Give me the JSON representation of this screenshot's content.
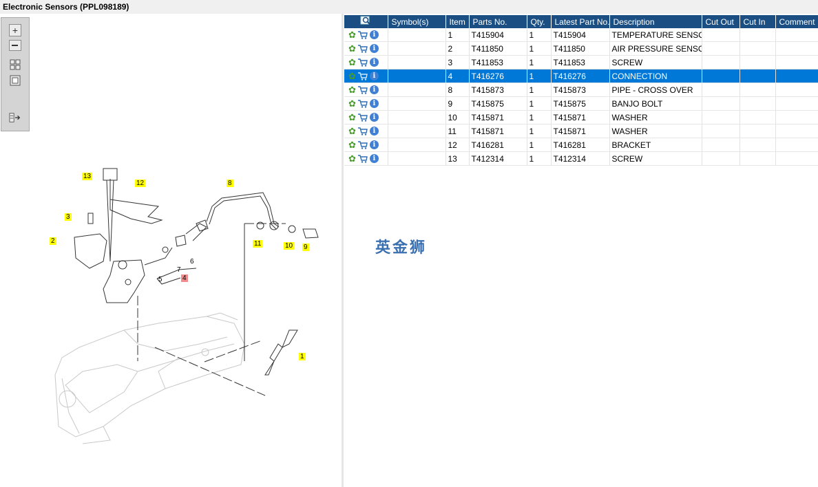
{
  "window": {
    "title": "Electronic Sensors (PPL098189)"
  },
  "toolbar": {
    "zoom_in_icon": "zoom-in-icon",
    "zoom_out_icon": "zoom-out-icon",
    "fit_icon": "fit-page-icon",
    "actual_size_icon": "actual-size-icon",
    "layout_icon": "layout-toggle-icon"
  },
  "drawing": {
    "callouts": [
      "13",
      "12",
      "8",
      "3",
      "2",
      "11",
      "10",
      "9",
      "4",
      "1"
    ],
    "labels": [
      "5",
      "6",
      "7"
    ]
  },
  "table": {
    "headers": {
      "actions": "",
      "symbols": "Symbol(s)",
      "item": "Item",
      "parts_no": "Parts No.",
      "qty": "Qty.",
      "latest": "Latest Part No.",
      "description": "Description",
      "cut_out": "Cut Out",
      "cut_in": "Cut In",
      "comment": "Comment"
    },
    "rows": [
      {
        "item": "1",
        "parts_no": "T415904",
        "qty": "1",
        "latest": "T415904",
        "description": "TEMPERATURE SENSOR"
      },
      {
        "item": "2",
        "parts_no": "T411850",
        "qty": "1",
        "latest": "T411850",
        "description": "AIR PRESSURE SENSOR"
      },
      {
        "item": "3",
        "parts_no": "T411853",
        "qty": "1",
        "latest": "T411853",
        "description": "SCREW"
      },
      {
        "item": "4",
        "parts_no": "T416276",
        "qty": "1",
        "latest": "T416276",
        "description": "CONNECTION",
        "selected": true
      },
      {
        "item": "8",
        "parts_no": "T415873",
        "qty": "1",
        "latest": "T415873",
        "description": "PIPE - CROSS OVER"
      },
      {
        "item": "9",
        "parts_no": "T415875",
        "qty": "1",
        "latest": "T415875",
        "description": "BANJO BOLT"
      },
      {
        "item": "10",
        "parts_no": "T415871",
        "qty": "1",
        "latest": "T415871",
        "description": "WASHER"
      },
      {
        "item": "11",
        "parts_no": "T415871",
        "qty": "1",
        "latest": "T415871",
        "description": "WASHER"
      },
      {
        "item": "12",
        "parts_no": "T416281",
        "qty": "1",
        "latest": "T416281",
        "description": "BRACKET"
      },
      {
        "item": "13",
        "parts_no": "T412314",
        "qty": "1",
        "latest": "T412314",
        "description": "SCREW"
      }
    ]
  },
  "watermark": "英金狮"
}
